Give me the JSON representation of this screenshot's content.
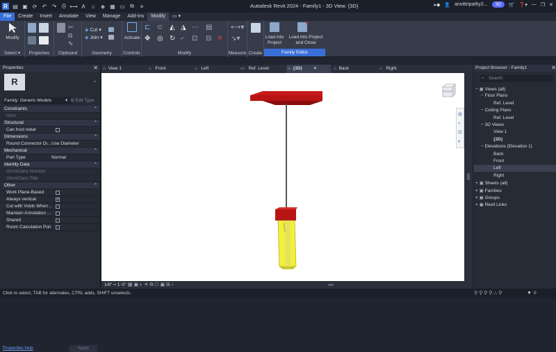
{
  "window": {
    "title": "Autodesk Revit 2024 - Family1 - 3D View: {3D}",
    "user": "anvittripathy2...",
    "badge": "3D"
  },
  "ribbon_tabs": [
    "File",
    "Create",
    "Insert",
    "Annotate",
    "View",
    "Manage",
    "Add-Ins",
    "Modify"
  ],
  "ribbon": {
    "modify_label": "Modify",
    "cut_label": "Cut",
    "join_label": "Join",
    "activate_label": "Activate",
    "load_into_project": "Load into Project",
    "load_into_project_close": "Load into Project and Close",
    "groups": [
      "Select",
      "Properties",
      "Clipboard",
      "Geometry",
      "Controls",
      "Modify",
      "Measure",
      "Create",
      "Family Editor"
    ]
  },
  "properties": {
    "title": "Properties",
    "family_selector": "Family: Generic Models",
    "edit_type": "Edit Type",
    "rows": [
      {
        "kind": "section",
        "name": "Constraints"
      },
      {
        "kind": "prop",
        "name": "Host",
        "value": "",
        "dim": true
      },
      {
        "kind": "section",
        "name": "Structural"
      },
      {
        "kind": "check",
        "name": "Can host rebar",
        "checked": false
      },
      {
        "kind": "section",
        "name": "Dimensions"
      },
      {
        "kind": "prop",
        "name": "Round Connector Di...",
        "value": "Use Diameter"
      },
      {
        "kind": "section",
        "name": "Mechanical"
      },
      {
        "kind": "prop",
        "name": "Part Type",
        "value": "Normal"
      },
      {
        "kind": "section",
        "name": "Identity Data"
      },
      {
        "kind": "prop",
        "name": "OmniClass Number",
        "value": "",
        "dim": true
      },
      {
        "kind": "prop",
        "name": "OmniClass Title",
        "value": "",
        "dim": true
      },
      {
        "kind": "section",
        "name": "Other"
      },
      {
        "kind": "check",
        "name": "Work Plane-Based",
        "checked": false
      },
      {
        "kind": "check",
        "name": "Always vertical",
        "checked": true
      },
      {
        "kind": "check",
        "name": "Cut with Voids When ...",
        "checked": false
      },
      {
        "kind": "check",
        "name": "Maintain Annotation ...",
        "checked": false
      },
      {
        "kind": "check",
        "name": "Shared",
        "checked": false
      },
      {
        "kind": "check",
        "name": "Room Calculation Point",
        "checked": false
      }
    ],
    "help_link": "Properties help",
    "apply": "Apply"
  },
  "view_tabs": [
    "View 1",
    "Front",
    "Left",
    "Ref. Level",
    "{3D}",
    "Back",
    "Right"
  ],
  "viewcube_label": "RIGHT",
  "view_control_bar": {
    "scale": "1/8\" = 1'-0\""
  },
  "project_browser": {
    "title": "Project Browser - Family1",
    "search_placeholder": "Search",
    "items": [
      {
        "label": "Views (all)",
        "level": 0
      },
      {
        "label": "Floor Plans",
        "level": 1
      },
      {
        "label": "Ref. Level",
        "level": 2
      },
      {
        "label": "Ceiling Plans",
        "level": 1
      },
      {
        "label": "Ref. Level",
        "level": 2
      },
      {
        "label": "3D Views",
        "level": 1
      },
      {
        "label": "View 1",
        "level": 2
      },
      {
        "label": "{3D}",
        "level": 2,
        "bold": true
      },
      {
        "label": "Elevations (Elevation 1)",
        "level": 1
      },
      {
        "label": "Back",
        "level": 2
      },
      {
        "label": "Front",
        "level": 2
      },
      {
        "label": "Left",
        "level": 2,
        "selected": true
      },
      {
        "label": "Right",
        "level": 2
      },
      {
        "label": "Sheets (all)",
        "level": 0
      },
      {
        "label": "Families",
        "level": 0
      },
      {
        "label": "Groups",
        "level": 0
      },
      {
        "label": "Revit Links",
        "level": 0
      }
    ]
  },
  "status_bar": {
    "message": "Click to select, TAB for alternates, CTRL adds, SHIFT unselects.",
    "filter_count": "0"
  },
  "colors": {
    "accent": "#3a6fd8",
    "model_red": "#a50e0e",
    "model_yellow": "#f2f03a",
    "canvas_bg": "#ffffff"
  }
}
